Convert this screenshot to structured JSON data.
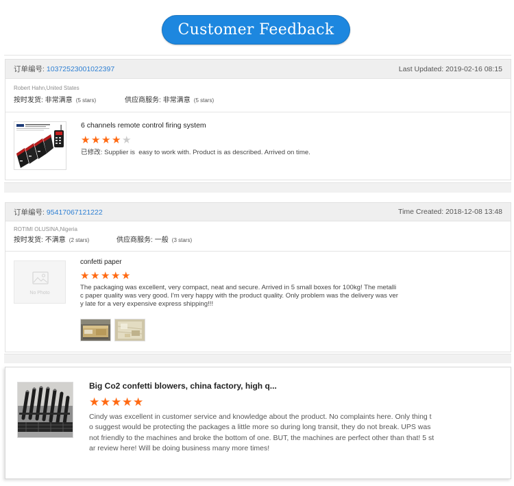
{
  "colors": {
    "accent": "#1d87df",
    "link": "#2d7fd3",
    "star": "#ff6a13",
    "star_empty": "#cccccc"
  },
  "icons": {
    "rating": "star-icon",
    "placeholder": "image-placeholder-icon"
  },
  "max_stars": 5,
  "banner": {
    "title": "Customer Feedback"
  },
  "reviews": [
    {
      "order_label": "订单编号:",
      "order_number": "10372523001022397",
      "date_text": "Last Updated: 2019-02-16 08:15",
      "reviewer": "Robert Hahn,United States",
      "ratings": [
        {
          "label": "按时发货:",
          "value": "非常满意",
          "stars_text": "(5 stars)"
        },
        {
          "label": "供应商服务:",
          "value": "非常满意",
          "stars_text": "(5 stars)"
        }
      ],
      "product_title": "6 channels remote control firing system",
      "product_rating": 4,
      "comment_lines": [
        "已修改: Supplier is  easy to work with. Product is as described. Arrived on time."
      ]
    },
    {
      "order_label": "订单编号:",
      "order_number": "95417067121222",
      "date_text": "Time Created: 2018-12-08 13:48",
      "reviewer": "ROTIMI OLUSINA,Nigeria",
      "ratings": [
        {
          "label": "按时发货:",
          "value": "不满意",
          "stars_text": "(2 stars)"
        },
        {
          "label": "供应商服务:",
          "value": "一般",
          "stars_text": "(3 stars)"
        }
      ],
      "no_photo_label": "No Photo",
      "product_title": "confetti paper",
      "product_rating": 5,
      "comment_lines": [
        "The packaging was excellent, very compact, neat and secure. Arrived in 5 small boxes for 100kg! The metalli",
        "c paper quality was very good. I'm very happy with the product quality. Only problem was the delivery was ver",
        "y late for a very expensive express shipping!!!"
      ]
    },
    {
      "product_title": "Big Co2 confetti blowers, china factory, high q...",
      "product_rating": 5,
      "comment_lines": [
        "Cindy was excellent in customer service and knowledge about the product. No complaints here. Only thing t",
        "o suggest would be protecting the packages a little more so during long transit, they do not break. UPS was",
        "not friendly to the machines and broke the bottom of one. BUT, the machines are perfect other than that! 5 st",
        "ar review here! Will be doing business many more times!"
      ]
    }
  ]
}
